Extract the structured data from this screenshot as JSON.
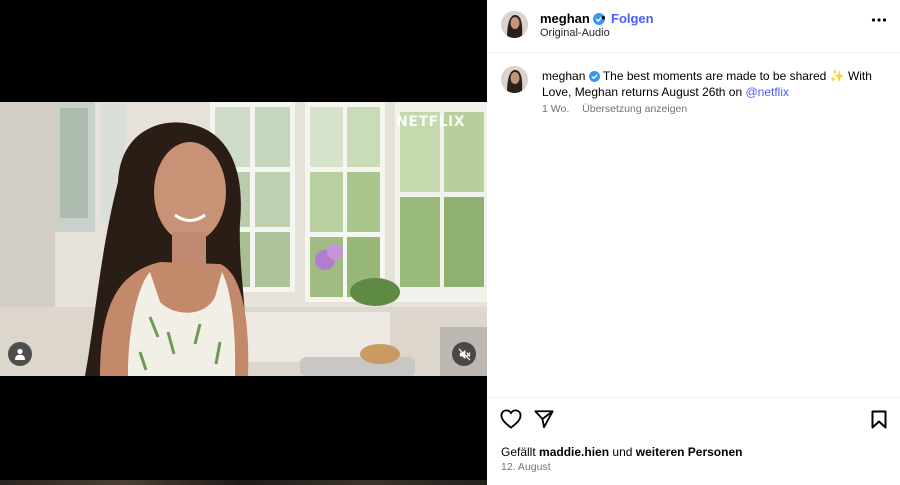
{
  "video": {
    "watermark": "NETFLIX",
    "user_icon": "user-icon",
    "mute_icon": "muted-speaker-icon"
  },
  "header": {
    "username": "meghan",
    "separator": "•",
    "follow_label": "Folgen",
    "audio_label": "Original-Audio",
    "more_icon": "more-options-icon"
  },
  "caption": {
    "username": "meghan",
    "text": "The best moments are made to be shared",
    "sparkle": "✨",
    "text_after": "With Love, Meghan returns August 26th on",
    "mention": "@netflix",
    "age": "1 Wo.",
    "translate_label": "Übersetzung anzeigen"
  },
  "actions": {
    "like_icon": "heart-icon",
    "share_icon": "paper-plane-icon",
    "save_icon": "bookmark-icon",
    "likes_prefix": "Gefällt",
    "liked_by": "maddie.hien",
    "likes_middle": "und",
    "likes_others": "weiteren Personen",
    "date": "12. August"
  },
  "colors": {
    "accent": "#4a5df9",
    "verified": "#3897f0",
    "muted_text": "#737373"
  }
}
